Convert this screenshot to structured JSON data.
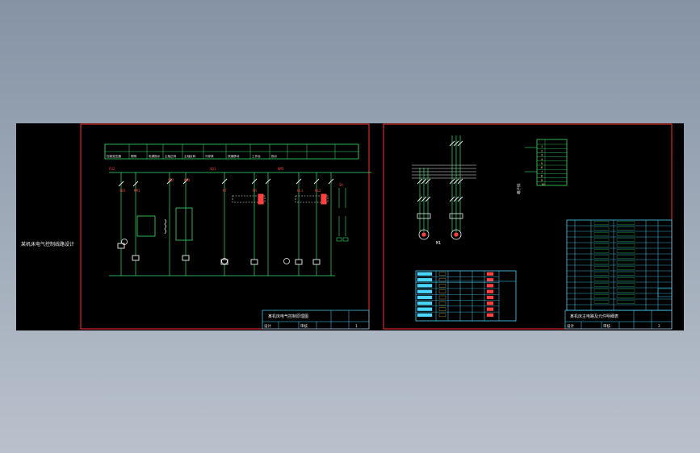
{
  "app": {
    "viewer": "CAD drawing preview",
    "background_colors": [
      "#8593a5",
      "#b9c1cc"
    ]
  },
  "colors": {
    "paper": "#000000",
    "frame": "#ff3030",
    "wire": "#36e06a",
    "component_white": "#f0f0f0",
    "label_red": "#ff4040",
    "table_cyan": "#4ad6ff",
    "table_yellow": "#ffe860",
    "table_green": "#3cd46c"
  },
  "sheet1": {
    "name": "control-schematic",
    "title_block": {
      "title": "某机床电气控制原理图",
      "drawn": "设计",
      "checked": "审核",
      "sheet_no": "1"
    },
    "ladder_labels": [
      "FU2",
      "SB1",
      "KM1",
      "SB2",
      "KM2",
      "SQ1",
      "KT",
      "FR",
      "KM3",
      "HL1",
      "HL2",
      "SA"
    ],
    "header_cells": [
      "控制变压器",
      "照明",
      "电源指示",
      "主轴正转",
      "主轴反转",
      "冷却泵",
      "快速移动",
      "工作台",
      "指示"
    ]
  },
  "sheet2": {
    "name": "main-circuit-and-lists",
    "motor_label": "M1",
    "terminal_label": "端子排",
    "terminal_rows": [
      "1",
      "2",
      "3",
      "4",
      "5",
      "6",
      "7",
      "8",
      "9",
      "10"
    ],
    "bom_rows": 16,
    "io_table_rows": 8,
    "title_block": {
      "title": "某机床主电路及元件明细表",
      "drawn": "设计",
      "checked": "审核",
      "sheet_no": "2"
    }
  },
  "side_note": {
    "text": "某机床电气控制线路设计"
  }
}
